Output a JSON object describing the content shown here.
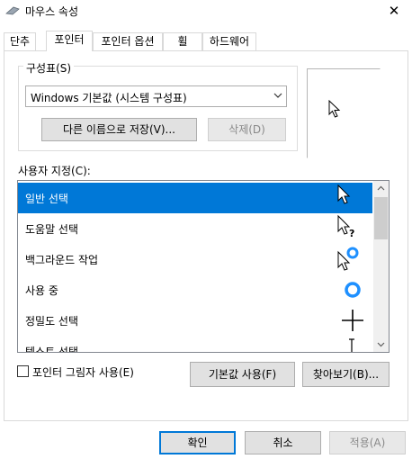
{
  "window": {
    "title": "마우스 속성",
    "close_glyph": "✕"
  },
  "tabs": [
    {
      "label": "단추",
      "active": false
    },
    {
      "label": "포인터",
      "active": true
    },
    {
      "label": "포인터 옵션",
      "active": false
    },
    {
      "label": "휠",
      "active": false
    },
    {
      "label": "하드웨어",
      "active": false
    }
  ],
  "scheme": {
    "group_label": "구성표(S)",
    "selected": "Windows 기본값 (시스템 구성표)",
    "save_as_label": "다른 이름으로 저장(V)...",
    "delete_label": "삭제(D)"
  },
  "custom": {
    "label": "사용자 지정(C):",
    "items": [
      {
        "label": "일반 선택",
        "icon": "arrow-cursor-icon",
        "selected": true
      },
      {
        "label": "도움말 선택",
        "icon": "help-cursor-icon",
        "selected": false
      },
      {
        "label": "백그라운드 작업",
        "icon": "working-in-background-cursor-icon",
        "selected": false
      },
      {
        "label": "사용 중",
        "icon": "busy-cursor-icon",
        "selected": false
      },
      {
        "label": "정밀도 선택",
        "icon": "crosshair-cursor-icon",
        "selected": false
      },
      {
        "label": "텍스트 선택",
        "icon": "text-beam-cursor-icon",
        "selected": false
      }
    ]
  },
  "shadow_checkbox": {
    "label": "포인터 그림자 사용(E)",
    "checked": false
  },
  "buttons": {
    "use_default": "기본값 사용(F)",
    "browse": "찾아보기(B)...",
    "ok": "확인",
    "cancel": "취소",
    "apply": "적용(A)"
  },
  "colors": {
    "accent": "#0078d7",
    "busy_ring": "#1e90ff"
  }
}
